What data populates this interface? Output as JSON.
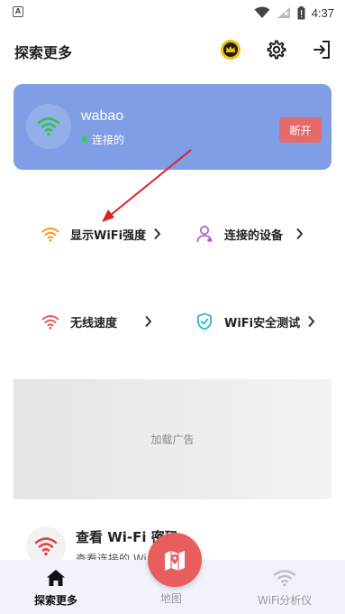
{
  "status_bar": {
    "time": "4:37"
  },
  "header": {
    "title": "探索更多"
  },
  "wifi_card": {
    "ssid": "wabao",
    "status": "连接的",
    "disconnect_label": "断开"
  },
  "features": [
    {
      "label": "显示WiFi强度",
      "icon": "wifi-orange-icon"
    },
    {
      "label": "连接的设备",
      "icon": "user-purple-icon"
    },
    {
      "label": "无线速度",
      "icon": "wifi-red-icon"
    },
    {
      "label": "WiFi安全测试",
      "icon": "shield-cyan-icon"
    }
  ],
  "ad": {
    "label": "加载广告"
  },
  "password_card": {
    "title": "查看 Wi-Fi 密码",
    "subtitle": "查看连接的 Wi"
  },
  "bottom_nav": [
    {
      "label": "探索更多",
      "active": true
    },
    {
      "label": "地图",
      "active": false
    },
    {
      "label": "WiFi分析仪",
      "active": false
    }
  ],
  "colors": {
    "card_bg": "#7f9ee6",
    "disconnect": "#e76a6a",
    "fab": "#e85d5d",
    "connected_dot": "#2fd05a",
    "crown_badge": "#f2c200"
  }
}
